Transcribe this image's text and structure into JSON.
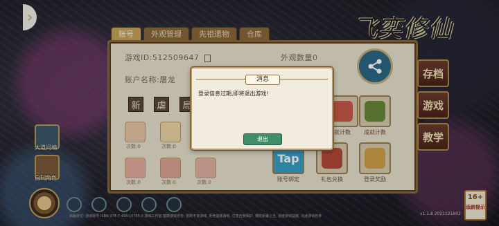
{
  "game": {
    "logo_text": "飞奕修仙"
  },
  "tabs": [
    {
      "label": "账号",
      "active": true
    },
    {
      "label": "外观管理",
      "active": false
    },
    {
      "label": "先祖遗物",
      "active": false
    },
    {
      "label": "仓库",
      "active": false
    }
  ],
  "account": {
    "game_id": "游戏ID:512509647",
    "appearance_count": "外观数量0",
    "account_name": "账户名称:屠龙"
  },
  "quick_buttons": [
    "新",
    "虐",
    "局"
  ],
  "items_row1": [
    "次数:0",
    "次数:0"
  ],
  "items_row2": [
    "次数:0",
    "次数:0",
    "次数:0"
  ],
  "grid": {
    "row1_labels": [
      "成就计数",
      "成就计数"
    ],
    "row2_labels": [
      "账号绑定",
      "礼包兑换",
      "登录奖励"
    ]
  },
  "side_buttons": [
    "存档",
    "游戏",
    "教学"
  ],
  "left_panel": [
    {
      "label": "大道问编",
      "icon": "mountain-icon"
    },
    {
      "label": "自制角色",
      "icon": "character-icon"
    }
  ],
  "age_rating": {
    "value": "16+",
    "note": "适龄提示"
  },
  "footer": "出版单位: 游戏版号 ISBN 978-7-498-10765-0 游戏工作室 健康游戏忠告: 抵制不良游戏, 拒绝盗版游戏, 注意自我保护, 谨防受骗上当, 适度游戏益脑, 沉迷游戏伤身",
  "version": "v1.1.8 2021121602",
  "modal": {
    "title": "消息",
    "message": "登录信息过期,即将退出游戏!",
    "button": "退出"
  }
}
